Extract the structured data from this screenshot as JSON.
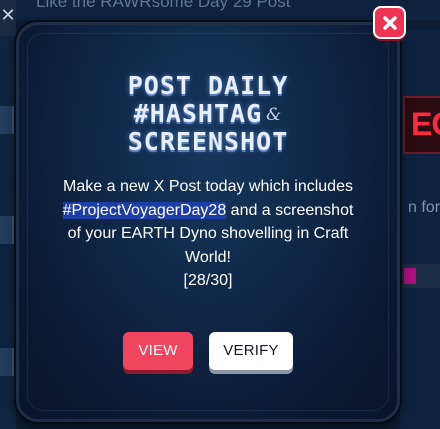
{
  "background": {
    "title": "Like the RAWRsome Day 29 Post",
    "close_glyph": "✕",
    "side_text": "n for C",
    "red_card_text": "EO"
  },
  "modal": {
    "title_line_1": "POST DAILY",
    "title_line_2": "#HASHTAG",
    "title_amp": "&",
    "title_line_3": "SCREENSHOT",
    "description_before": "Make a new X Post today which includes ",
    "hashtag": "#ProjectVoyagerDay28",
    "description_after": " and a screenshot of your EARTH Dyno shovelling in Craft World!",
    "progress": "[28/30]",
    "view_label": "VIEW",
    "verify_label": "VERIFY",
    "close_icon": "close-icon"
  },
  "colors": {
    "accent_red": "#f0445f",
    "close_red": "#ee3353",
    "hashtag_highlight": "#1d3fa5",
    "modal_bg": "#0f2646"
  }
}
